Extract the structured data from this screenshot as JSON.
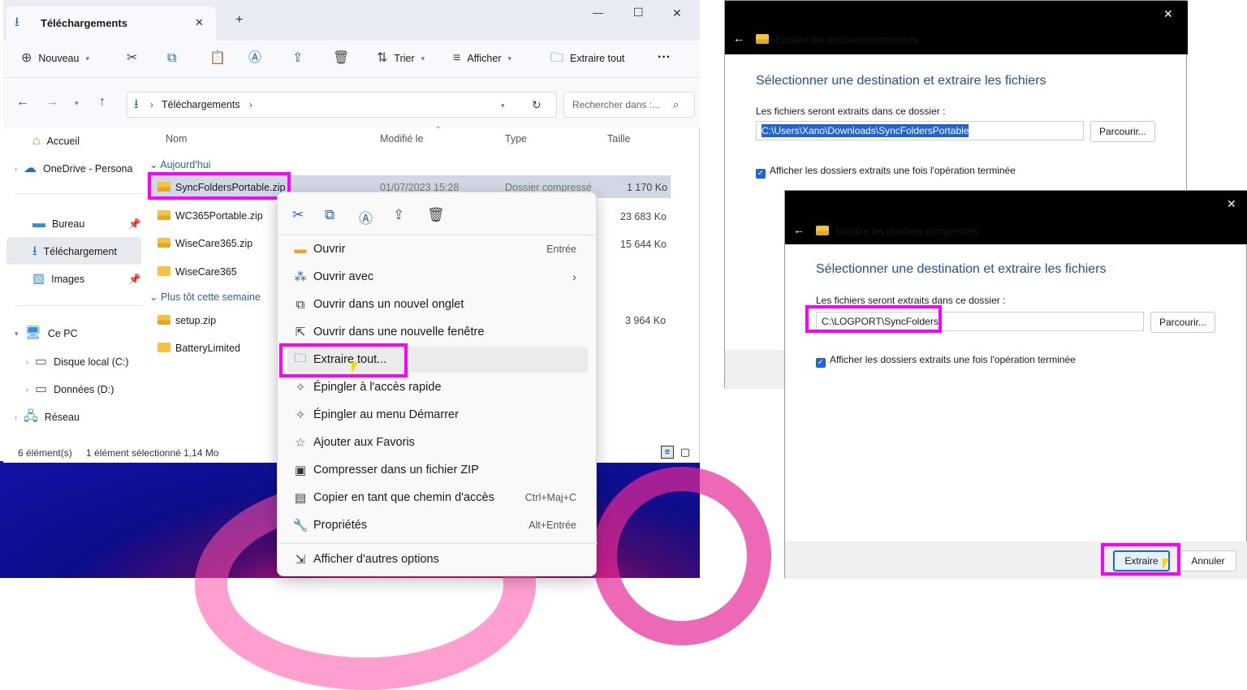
{
  "explorer": {
    "tab_title": "Téléchargements",
    "close_tab": "✕",
    "new_tab": "+",
    "window_controls": {
      "minimize": "—",
      "maximize": "☐",
      "close": "✕"
    },
    "toolbar": {
      "new_label": "Nouveau",
      "sort_label": "Trier",
      "view_label": "Afficher",
      "extract_all_label": "Extraire tout",
      "more_label": "···"
    },
    "address": {
      "path_label": "Téléchargements",
      "search_placeholder": "Rechercher dans :..."
    },
    "nav": {
      "home": "Accueil",
      "onedrive": "OneDrive - Persona",
      "desktop": "Bureau",
      "downloads": "Téléchargement",
      "images": "Images",
      "pc": "Ce PC",
      "local_disk": "Disque local (C:)",
      "data_disk": "Données (D:)",
      "network": "Réseau"
    },
    "columns": {
      "name": "Nom",
      "modified": "Modifié le",
      "type": "Type",
      "size": "Taille"
    },
    "groups": {
      "today": "Aujourd'hui",
      "earlier": "Plus tôt cette semaine"
    },
    "files": [
      {
        "name": "SyncFoldersPortable.zip",
        "modified": "01/07/2023 15:28",
        "type": "Dossier compressé",
        "size": "1 170 Ko"
      },
      {
        "name": "WC365Portable.zip",
        "size": "23 683 Ko"
      },
      {
        "name": "WiseCare365.zip",
        "size": "15 644 Ko"
      },
      {
        "name": "WiseCare365",
        "size": ""
      },
      {
        "name": "setup.zip",
        "size": "3 964 Ko"
      },
      {
        "name": "BatteryLimited",
        "size": ""
      }
    ],
    "status": {
      "count": "6 élément(s)",
      "selection": "1 élément sélectionné  1,14 Mo"
    }
  },
  "context_menu": {
    "items": [
      {
        "label": "Ouvrir",
        "shortcut": "Entrée"
      },
      {
        "label": "Ouvrir avec",
        "shortcut": "›"
      },
      {
        "label": "Ouvrir dans un nouvel onglet",
        "shortcut": ""
      },
      {
        "label": "Ouvrir dans une nouvelle fenêtre",
        "shortcut": ""
      },
      {
        "label": "Extraire tout...",
        "shortcut": ""
      },
      {
        "label": "Épingler à l'accès rapide",
        "shortcut": ""
      },
      {
        "label": "Épingler au menu Démarrer",
        "shortcut": ""
      },
      {
        "label": "Ajouter aux Favoris",
        "shortcut": ""
      },
      {
        "label": "Compresser dans un fichier ZIP",
        "shortcut": ""
      },
      {
        "label": "Copier en tant que chemin d'accès",
        "shortcut": "Ctrl+Maj+C"
      },
      {
        "label": "Propriétés",
        "shortcut": "Alt+Entrée"
      },
      {
        "label": "Afficher d'autres options",
        "shortcut": ""
      }
    ]
  },
  "dialog1": {
    "title": "Extraire les dossiers compressés",
    "heading": "Sélectionner une destination et extraire les fichiers",
    "label": "Les fichiers seront extraits dans ce dossier :",
    "path": "C:\\Users\\Xano\\Downloads\\SyncFoldersPortable",
    "browse": "Parcourir...",
    "checkbox": "Afficher les dossiers extraits une fois l'opération terminée"
  },
  "dialog2": {
    "title": "Extraire les dossiers compressés",
    "heading": "Sélectionner une destination et extraire les fichiers",
    "label": "Les fichiers seront extraits dans ce dossier :",
    "path": "C:\\LOGPORT\\SyncFolders",
    "browse": "Parcourir...",
    "checkbox": "Afficher les dossiers extraits une fois l'opération terminée",
    "extract": "Extraire",
    "cancel": "Annuler"
  },
  "colors": {
    "highlight": "#ff00ff",
    "accent": "#1f63d8"
  }
}
